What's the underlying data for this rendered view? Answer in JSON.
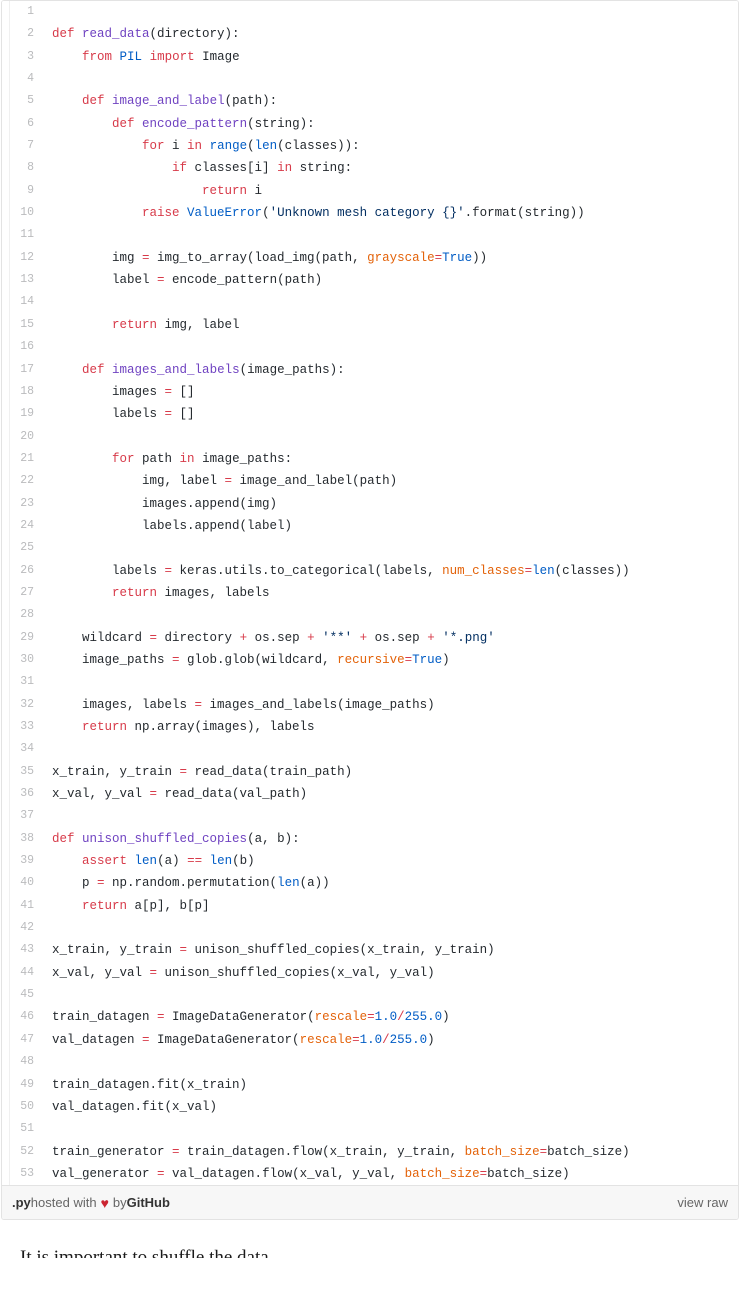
{
  "gist": {
    "lines": [
      {
        "n": "1",
        "tokens": []
      },
      {
        "n": "2",
        "tokens": [
          {
            "t": "k",
            "v": "def"
          },
          {
            "t": "n",
            "v": " "
          },
          {
            "t": "nf",
            "v": "read_data"
          },
          {
            "t": "n",
            "v": "(directory):"
          }
        ]
      },
      {
        "n": "3",
        "tokens": [
          {
            "t": "n",
            "v": "    "
          },
          {
            "t": "k",
            "v": "from"
          },
          {
            "t": "n",
            "v": " "
          },
          {
            "t": "nb",
            "v": "PIL"
          },
          {
            "t": "n",
            "v": " "
          },
          {
            "t": "k",
            "v": "import"
          },
          {
            "t": "n",
            "v": " Image"
          }
        ]
      },
      {
        "n": "4",
        "tokens": []
      },
      {
        "n": "5",
        "tokens": [
          {
            "t": "n",
            "v": "    "
          },
          {
            "t": "k",
            "v": "def"
          },
          {
            "t": "n",
            "v": " "
          },
          {
            "t": "nf",
            "v": "image_and_label"
          },
          {
            "t": "n",
            "v": "(path):"
          }
        ]
      },
      {
        "n": "6",
        "tokens": [
          {
            "t": "n",
            "v": "        "
          },
          {
            "t": "k",
            "v": "def"
          },
          {
            "t": "n",
            "v": " "
          },
          {
            "t": "nf",
            "v": "encode_pattern"
          },
          {
            "t": "n",
            "v": "(string):"
          }
        ]
      },
      {
        "n": "7",
        "tokens": [
          {
            "t": "n",
            "v": "            "
          },
          {
            "t": "k",
            "v": "for"
          },
          {
            "t": "n",
            "v": " i "
          },
          {
            "t": "k",
            "v": "in"
          },
          {
            "t": "n",
            "v": " "
          },
          {
            "t": "nb",
            "v": "range"
          },
          {
            "t": "n",
            "v": "("
          },
          {
            "t": "nb",
            "v": "len"
          },
          {
            "t": "n",
            "v": "(classes)):"
          }
        ]
      },
      {
        "n": "8",
        "tokens": [
          {
            "t": "n",
            "v": "                "
          },
          {
            "t": "k",
            "v": "if"
          },
          {
            "t": "n",
            "v": " classes[i] "
          },
          {
            "t": "k",
            "v": "in"
          },
          {
            "t": "n",
            "v": " string:"
          }
        ]
      },
      {
        "n": "9",
        "tokens": [
          {
            "t": "n",
            "v": "                    "
          },
          {
            "t": "k",
            "v": "return"
          },
          {
            "t": "n",
            "v": " i"
          }
        ]
      },
      {
        "n": "10",
        "tokens": [
          {
            "t": "n",
            "v": "            "
          },
          {
            "t": "k",
            "v": "raise"
          },
          {
            "t": "n",
            "v": " "
          },
          {
            "t": "nb",
            "v": "ValueError"
          },
          {
            "t": "n",
            "v": "("
          },
          {
            "t": "s",
            "v": "'Unknown mesh category {}'"
          },
          {
            "t": "n",
            "v": ".format(string))"
          }
        ]
      },
      {
        "n": "11",
        "tokens": []
      },
      {
        "n": "12",
        "tokens": [
          {
            "t": "n",
            "v": "        img "
          },
          {
            "t": "o",
            "v": "="
          },
          {
            "t": "n",
            "v": " img_to_array(load_img(path, "
          },
          {
            "t": "kw",
            "v": "grayscale"
          },
          {
            "t": "o",
            "v": "="
          },
          {
            "t": "nb",
            "v": "True"
          },
          {
            "t": "n",
            "v": "))"
          }
        ]
      },
      {
        "n": "13",
        "tokens": [
          {
            "t": "n",
            "v": "        label "
          },
          {
            "t": "o",
            "v": "="
          },
          {
            "t": "n",
            "v": " encode_pattern(path)"
          }
        ]
      },
      {
        "n": "14",
        "tokens": []
      },
      {
        "n": "15",
        "tokens": [
          {
            "t": "n",
            "v": "        "
          },
          {
            "t": "k",
            "v": "return"
          },
          {
            "t": "n",
            "v": " img, label"
          }
        ]
      },
      {
        "n": "16",
        "tokens": []
      },
      {
        "n": "17",
        "tokens": [
          {
            "t": "n",
            "v": "    "
          },
          {
            "t": "k",
            "v": "def"
          },
          {
            "t": "n",
            "v": " "
          },
          {
            "t": "nf",
            "v": "images_and_labels"
          },
          {
            "t": "n",
            "v": "(image_paths):"
          }
        ]
      },
      {
        "n": "18",
        "tokens": [
          {
            "t": "n",
            "v": "        images "
          },
          {
            "t": "o",
            "v": "="
          },
          {
            "t": "n",
            "v": " []"
          }
        ]
      },
      {
        "n": "19",
        "tokens": [
          {
            "t": "n",
            "v": "        labels "
          },
          {
            "t": "o",
            "v": "="
          },
          {
            "t": "n",
            "v": " []"
          }
        ]
      },
      {
        "n": "20",
        "tokens": []
      },
      {
        "n": "21",
        "tokens": [
          {
            "t": "n",
            "v": "        "
          },
          {
            "t": "k",
            "v": "for"
          },
          {
            "t": "n",
            "v": " path "
          },
          {
            "t": "k",
            "v": "in"
          },
          {
            "t": "n",
            "v": " image_paths:"
          }
        ]
      },
      {
        "n": "22",
        "tokens": [
          {
            "t": "n",
            "v": "            img, label "
          },
          {
            "t": "o",
            "v": "="
          },
          {
            "t": "n",
            "v": " image_and_label(path)"
          }
        ]
      },
      {
        "n": "23",
        "tokens": [
          {
            "t": "n",
            "v": "            images.append(img)"
          }
        ]
      },
      {
        "n": "24",
        "tokens": [
          {
            "t": "n",
            "v": "            labels.append(label)"
          }
        ]
      },
      {
        "n": "25",
        "tokens": []
      },
      {
        "n": "26",
        "tokens": [
          {
            "t": "n",
            "v": "        labels "
          },
          {
            "t": "o",
            "v": "="
          },
          {
            "t": "n",
            "v": " keras.utils.to_categorical(labels, "
          },
          {
            "t": "kw",
            "v": "num_classes"
          },
          {
            "t": "o",
            "v": "="
          },
          {
            "t": "nb",
            "v": "len"
          },
          {
            "t": "n",
            "v": "(classes))"
          }
        ]
      },
      {
        "n": "27",
        "tokens": [
          {
            "t": "n",
            "v": "        "
          },
          {
            "t": "k",
            "v": "return"
          },
          {
            "t": "n",
            "v": " images, labels"
          }
        ]
      },
      {
        "n": "28",
        "tokens": []
      },
      {
        "n": "29",
        "tokens": [
          {
            "t": "n",
            "v": "    wildcard "
          },
          {
            "t": "o",
            "v": "="
          },
          {
            "t": "n",
            "v": " directory "
          },
          {
            "t": "o",
            "v": "+"
          },
          {
            "t": "n",
            "v": " os.sep "
          },
          {
            "t": "o",
            "v": "+"
          },
          {
            "t": "n",
            "v": " "
          },
          {
            "t": "s",
            "v": "'**'"
          },
          {
            "t": "n",
            "v": " "
          },
          {
            "t": "o",
            "v": "+"
          },
          {
            "t": "n",
            "v": " os.sep "
          },
          {
            "t": "o",
            "v": "+"
          },
          {
            "t": "n",
            "v": " "
          },
          {
            "t": "s",
            "v": "'*.png'"
          }
        ]
      },
      {
        "n": "30",
        "tokens": [
          {
            "t": "n",
            "v": "    image_paths "
          },
          {
            "t": "o",
            "v": "="
          },
          {
            "t": "n",
            "v": " glob.glob(wildcard, "
          },
          {
            "t": "kw",
            "v": "recursive"
          },
          {
            "t": "o",
            "v": "="
          },
          {
            "t": "nb",
            "v": "True"
          },
          {
            "t": "n",
            "v": ")"
          }
        ]
      },
      {
        "n": "31",
        "tokens": []
      },
      {
        "n": "32",
        "tokens": [
          {
            "t": "n",
            "v": "    images, labels "
          },
          {
            "t": "o",
            "v": "="
          },
          {
            "t": "n",
            "v": " images_and_labels(image_paths)"
          }
        ]
      },
      {
        "n": "33",
        "tokens": [
          {
            "t": "n",
            "v": "    "
          },
          {
            "t": "k",
            "v": "return"
          },
          {
            "t": "n",
            "v": " np.array(images), labels"
          }
        ]
      },
      {
        "n": "34",
        "tokens": []
      },
      {
        "n": "35",
        "tokens": [
          {
            "t": "n",
            "v": "x_train, y_train "
          },
          {
            "t": "o",
            "v": "="
          },
          {
            "t": "n",
            "v": " read_data(train_path)"
          }
        ]
      },
      {
        "n": "36",
        "tokens": [
          {
            "t": "n",
            "v": "x_val, y_val "
          },
          {
            "t": "o",
            "v": "="
          },
          {
            "t": "n",
            "v": " read_data(val_path)"
          }
        ]
      },
      {
        "n": "37",
        "tokens": []
      },
      {
        "n": "38",
        "tokens": [
          {
            "t": "k",
            "v": "def"
          },
          {
            "t": "n",
            "v": " "
          },
          {
            "t": "nf",
            "v": "unison_shuffled_copies"
          },
          {
            "t": "n",
            "v": "(a, b):"
          }
        ]
      },
      {
        "n": "39",
        "tokens": [
          {
            "t": "n",
            "v": "    "
          },
          {
            "t": "k",
            "v": "assert"
          },
          {
            "t": "n",
            "v": " "
          },
          {
            "t": "nb",
            "v": "len"
          },
          {
            "t": "n",
            "v": "(a) "
          },
          {
            "t": "o",
            "v": "=="
          },
          {
            "t": "n",
            "v": " "
          },
          {
            "t": "nb",
            "v": "len"
          },
          {
            "t": "n",
            "v": "(b)"
          }
        ]
      },
      {
        "n": "40",
        "tokens": [
          {
            "t": "n",
            "v": "    p "
          },
          {
            "t": "o",
            "v": "="
          },
          {
            "t": "n",
            "v": " np.random.permutation("
          },
          {
            "t": "nb",
            "v": "len"
          },
          {
            "t": "n",
            "v": "(a))"
          }
        ]
      },
      {
        "n": "41",
        "tokens": [
          {
            "t": "n",
            "v": "    "
          },
          {
            "t": "k",
            "v": "return"
          },
          {
            "t": "n",
            "v": " a[p], b[p]"
          }
        ]
      },
      {
        "n": "42",
        "tokens": []
      },
      {
        "n": "43",
        "tokens": [
          {
            "t": "n",
            "v": "x_train, y_train "
          },
          {
            "t": "o",
            "v": "="
          },
          {
            "t": "n",
            "v": " unison_shuffled_copies(x_train, y_train)"
          }
        ]
      },
      {
        "n": "44",
        "tokens": [
          {
            "t": "n",
            "v": "x_val, y_val "
          },
          {
            "t": "o",
            "v": "="
          },
          {
            "t": "n",
            "v": " unison_shuffled_copies(x_val, y_val)"
          }
        ]
      },
      {
        "n": "45",
        "tokens": []
      },
      {
        "n": "46",
        "tokens": [
          {
            "t": "n",
            "v": "train_datagen "
          },
          {
            "t": "o",
            "v": "="
          },
          {
            "t": "n",
            "v": " ImageDataGenerator("
          },
          {
            "t": "kw",
            "v": "rescale"
          },
          {
            "t": "o",
            "v": "="
          },
          {
            "t": "nb",
            "v": "1.0"
          },
          {
            "t": "o",
            "v": "/"
          },
          {
            "t": "nb",
            "v": "255.0"
          },
          {
            "t": "n",
            "v": ")"
          }
        ]
      },
      {
        "n": "47",
        "tokens": [
          {
            "t": "n",
            "v": "val_datagen "
          },
          {
            "t": "o",
            "v": "="
          },
          {
            "t": "n",
            "v": " ImageDataGenerator("
          },
          {
            "t": "kw",
            "v": "rescale"
          },
          {
            "t": "o",
            "v": "="
          },
          {
            "t": "nb",
            "v": "1.0"
          },
          {
            "t": "o",
            "v": "/"
          },
          {
            "t": "nb",
            "v": "255.0"
          },
          {
            "t": "n",
            "v": ")"
          }
        ]
      },
      {
        "n": "48",
        "tokens": []
      },
      {
        "n": "49",
        "tokens": [
          {
            "t": "n",
            "v": "train_datagen.fit(x_train)"
          }
        ]
      },
      {
        "n": "50",
        "tokens": [
          {
            "t": "n",
            "v": "val_datagen.fit(x_val)"
          }
        ]
      },
      {
        "n": "51",
        "tokens": []
      },
      {
        "n": "52",
        "tokens": [
          {
            "t": "n",
            "v": "train_generator "
          },
          {
            "t": "o",
            "v": "="
          },
          {
            "t": "n",
            "v": " train_datagen.flow(x_train, y_train, "
          },
          {
            "t": "kw",
            "v": "batch_size"
          },
          {
            "t": "o",
            "v": "="
          },
          {
            "t": "n",
            "v": "batch_size)"
          }
        ]
      },
      {
        "n": "53",
        "tokens": [
          {
            "t": "n",
            "v": "val_generator "
          },
          {
            "t": "o",
            "v": "="
          },
          {
            "t": "n",
            "v": " val_datagen.flow(x_val, y_val, "
          },
          {
            "t": "kw",
            "v": "batch_size"
          },
          {
            "t": "o",
            "v": "="
          },
          {
            "t": "n",
            "v": "batch_size)"
          }
        ]
      }
    ],
    "meta": {
      "extension": ".py",
      "hosted_with": " hosted with ",
      "heart": "♥",
      "by": " by ",
      "provider": "GitHub",
      "view_raw": "view raw"
    }
  },
  "below_text": "It is important to shuffle the data",
  "colors": {
    "keyword": "#d73a49",
    "function": "#6f42c1",
    "builtin": "#005cc5",
    "string": "#032f62",
    "kwarg": "#e36209",
    "text": "#24292e",
    "line_number": "#babbbd",
    "border": "#e3e3e3",
    "footer_bg": "#f7f7f7",
    "heart": "#cb2431"
  }
}
